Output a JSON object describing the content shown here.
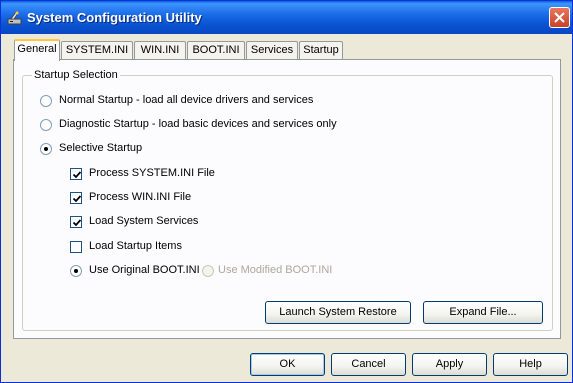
{
  "window": {
    "title": "System Configuration Utility"
  },
  "tabs": [
    {
      "label": "General",
      "active": true
    },
    {
      "label": "SYSTEM.INI",
      "active": false
    },
    {
      "label": "WIN.INI",
      "active": false
    },
    {
      "label": "BOOT.INI",
      "active": false
    },
    {
      "label": "Services",
      "active": false
    },
    {
      "label": "Startup",
      "active": false
    }
  ],
  "startup_selection": {
    "legend": "Startup Selection",
    "options": [
      {
        "label": "Normal Startup - load all device drivers and services",
        "selected": false
      },
      {
        "label": "Diagnostic Startup - load basic devices and services only",
        "selected": false
      },
      {
        "label": "Selective Startup",
        "selected": true
      }
    ],
    "selective_items": [
      {
        "label": "Process SYSTEM.INI File",
        "checked": true
      },
      {
        "label": "Process WIN.INI File",
        "checked": true
      },
      {
        "label": "Load System Services",
        "checked": true
      },
      {
        "label": "Load Startup Items",
        "checked": false
      }
    ],
    "boot_options": [
      {
        "label": "Use Original BOOT.INI",
        "selected": true,
        "enabled": true
      },
      {
        "label": "Use Modified BOOT.INI",
        "selected": false,
        "enabled": false
      }
    ],
    "launch_restore_label": "Launch System Restore",
    "expand_file_label": "Expand File..."
  },
  "dialog_buttons": {
    "ok": "OK",
    "cancel": "Cancel",
    "apply": "Apply",
    "help": "Help"
  },
  "icons": {
    "app": "system-config-icon",
    "close": "close-icon"
  },
  "colors": {
    "titlebar": "#0a54d2",
    "close_button": "#c8422a",
    "tab_highlight": "#ffc83c"
  }
}
